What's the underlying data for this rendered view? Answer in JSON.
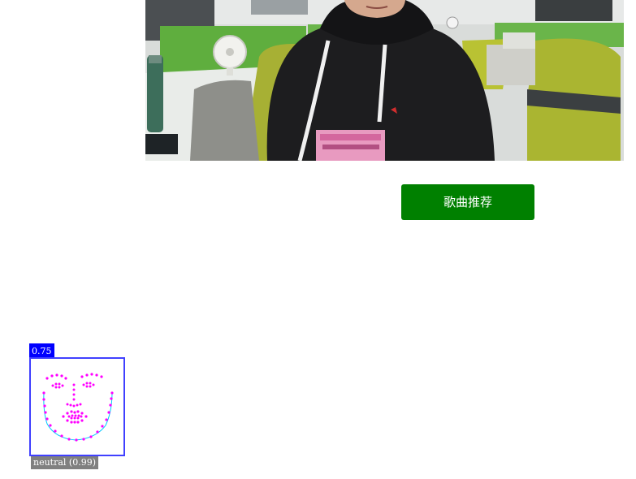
{
  "video": {
    "icon": "webcam-feed"
  },
  "recommend_button": {
    "label": "歌曲推荐",
    "color": "#008000"
  },
  "face_detection": {
    "score": "0.75",
    "expression": "neutral (0.99)",
    "box_color": "#0000ff",
    "landmark_color": "#ff00ff",
    "outline_color": "#00c8ff"
  }
}
